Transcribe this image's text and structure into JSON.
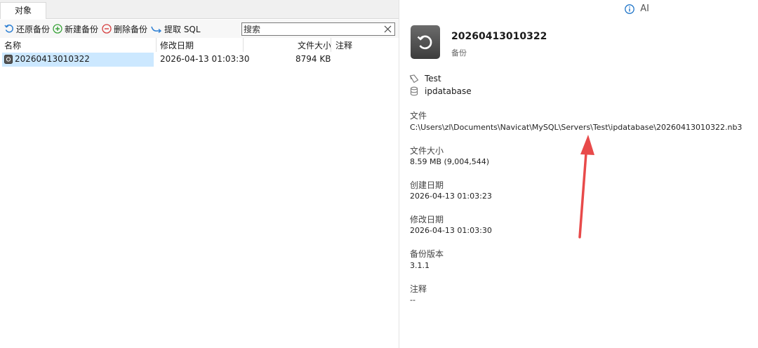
{
  "tabs": [
    {
      "label": "对象"
    }
  ],
  "toolbar": {
    "restore_label": "还原备份",
    "new_label": "新建备份",
    "delete_label": "删除备份",
    "extract_label": "提取 SQL"
  },
  "search": {
    "placeholder": "搜索",
    "value": ""
  },
  "table": {
    "columns": [
      "名称",
      "修改日期",
      "文件大小",
      "注释"
    ],
    "rows": [
      {
        "name": "20260413010322",
        "modified": "2026-04-13 01:03:30",
        "size": "8794 KB",
        "comment": ""
      }
    ]
  },
  "detail": {
    "ai_label": "AI",
    "title": "20260413010322",
    "subtitle": "备份",
    "connection": "Test",
    "database": "ipdatabase",
    "file_label": "文件",
    "file_value": "C:\\Users\\zl\\Documents\\Navicat\\MySQL\\Servers\\Test\\ipdatabase\\20260413010322.nb3",
    "size_label": "文件大小",
    "size_value": "8.59 MB (9,004,544)",
    "created_label": "创建日期",
    "created_value": "2026-04-13 01:03:23",
    "modified_label": "修改日期",
    "modified_value": "2026-04-13 01:03:30",
    "version_label": "备份版本",
    "version_value": "3.1.1",
    "comment_label": "注释",
    "comment_value": "--"
  },
  "colors": {
    "selection": "#cce8ff",
    "restore_icon": "#2d7fd3",
    "new_icon": "#3aa33a",
    "delete_icon": "#d64040",
    "annotation_arrow": "#e84a4a",
    "info_icon": "#1e74c8"
  },
  "icons": {
    "restore": "restore-icon",
    "new": "add-icon",
    "delete": "remove-icon",
    "extract": "extract-sql-icon",
    "search_clear": "close-icon",
    "info": "info-icon",
    "backup": "backup-file-icon",
    "connection": "connection-icon",
    "database": "database-icon"
  }
}
